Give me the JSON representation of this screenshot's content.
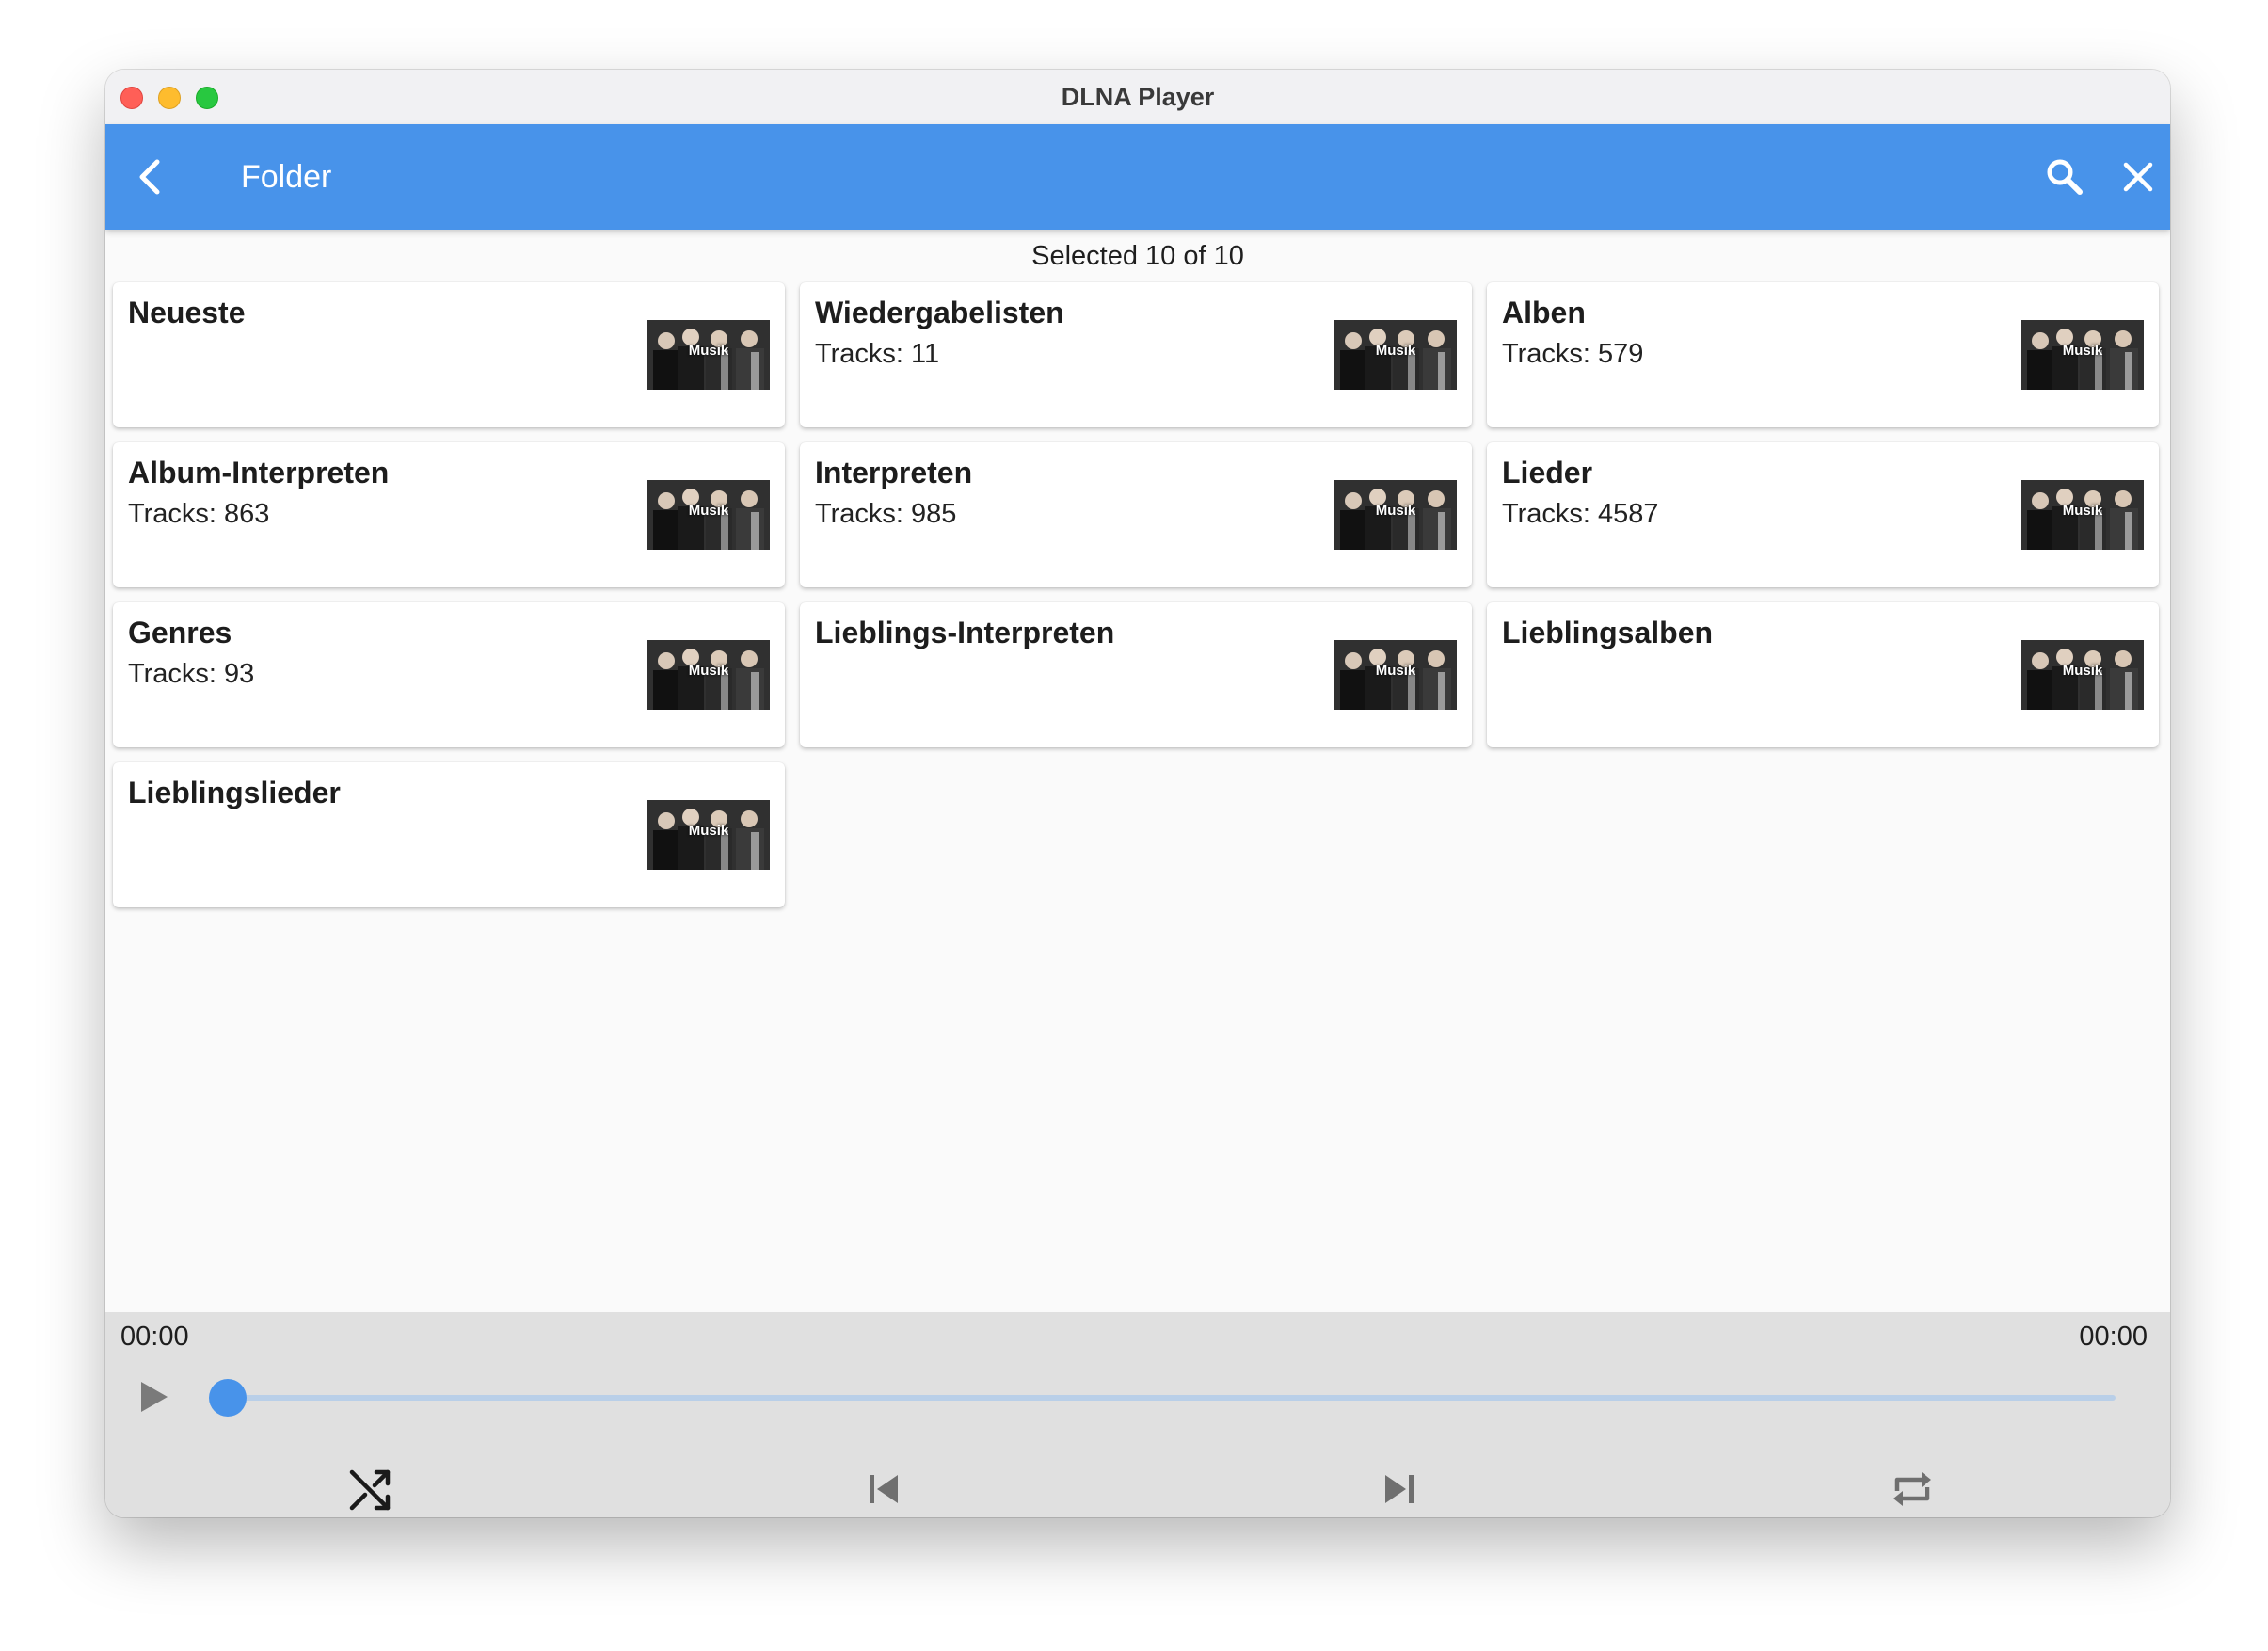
{
  "window": {
    "title": "DLNA Player"
  },
  "appbar": {
    "title": "Folder",
    "back_icon": "arrow-back-icon",
    "search_icon": "search-icon",
    "close_icon": "close-icon",
    "color": "#4893ea"
  },
  "selection": {
    "text": "Selected 10 of 10"
  },
  "folders": [
    {
      "name": "Neueste",
      "tracks": "",
      "thumb_label": "Musik"
    },
    {
      "name": "Wiedergabelisten",
      "tracks": "Tracks: 11",
      "thumb_label": "Musik"
    },
    {
      "name": "Alben",
      "tracks": "Tracks: 579",
      "thumb_label": "Musik"
    },
    {
      "name": "Album-Interpreten",
      "tracks": "Tracks: 863",
      "thumb_label": "Musik"
    },
    {
      "name": "Interpreten",
      "tracks": "Tracks: 985",
      "thumb_label": "Musik"
    },
    {
      "name": "Lieder",
      "tracks": "Tracks: 4587",
      "thumb_label": "Musik"
    },
    {
      "name": "Genres",
      "tracks": "Tracks: 93",
      "thumb_label": "Musik"
    },
    {
      "name": "Lieblings-Interpreten",
      "tracks": "",
      "thumb_label": "Musik"
    },
    {
      "name": "Lieblingsalben",
      "tracks": "",
      "thumb_label": "Musik"
    },
    {
      "name": "Lieblingslieder",
      "tracks": "",
      "thumb_label": "Musik"
    }
  ],
  "player": {
    "position": "00:00",
    "duration": "00:00",
    "progress": 0,
    "controls": [
      "play-icon",
      "shuffle-icon",
      "skip-previous-icon",
      "skip-next-icon",
      "repeat-icon"
    ]
  }
}
